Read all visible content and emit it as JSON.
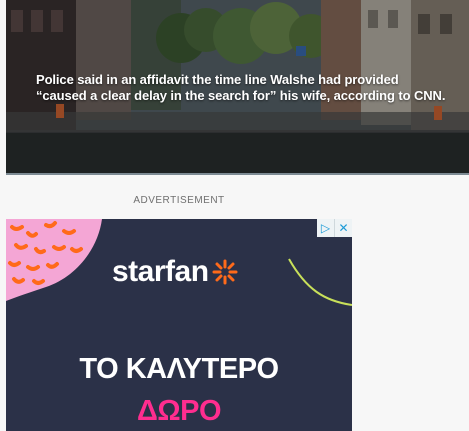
{
  "video": {
    "caption_line_1": "Police said in an affidavit the time line Walshe had provided",
    "caption_line_2": "“caused a clear delay in the search for” his wife, according to CNN."
  },
  "advertisement": {
    "label": "ADVERTISEMENT",
    "brand": "starfan",
    "headline_line_1": "ΤΟ ΚΑΛΥΤΕΡΟ",
    "headline_line_2": "ΔΩΡΟ",
    "ad_choices_icon": "▷",
    "close_icon": "✕",
    "colors": {
      "background": "#2b3148",
      "accent_pink": "#ff2d8f",
      "accent_orange": "#ff6a1a",
      "accent_lime": "#c8e05a"
    }
  }
}
